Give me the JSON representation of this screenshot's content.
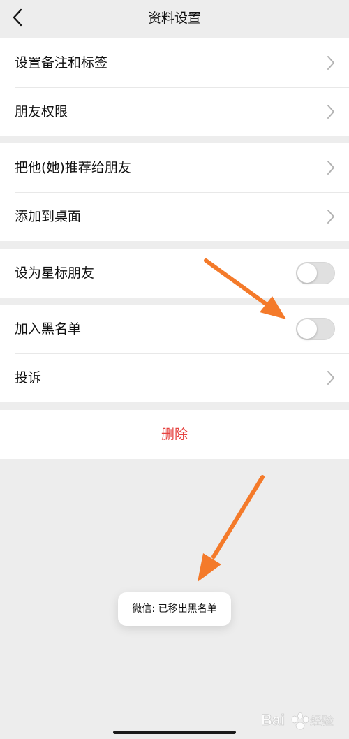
{
  "nav": {
    "title": "资料设置"
  },
  "groups": [
    {
      "items": [
        {
          "label": "设置备注和标签"
        },
        {
          "label": "朋友权限"
        }
      ]
    },
    {
      "items": [
        {
          "label": "把他(她)推荐给朋友"
        },
        {
          "label": "添加到桌面"
        }
      ]
    },
    {
      "items": [
        {
          "label": "设为星标朋友",
          "toggle": false
        }
      ]
    },
    {
      "items": [
        {
          "label": "加入黑名单",
          "toggle": false
        },
        {
          "label": "投诉"
        }
      ]
    }
  ],
  "delete_label": "删除",
  "toast": "微信: 已移出黑名单",
  "colors": {
    "background": "#ededed",
    "delete_red": "#e64340",
    "annotation_arrow": "#f47a2a"
  },
  "watermark": "Baidu经验"
}
